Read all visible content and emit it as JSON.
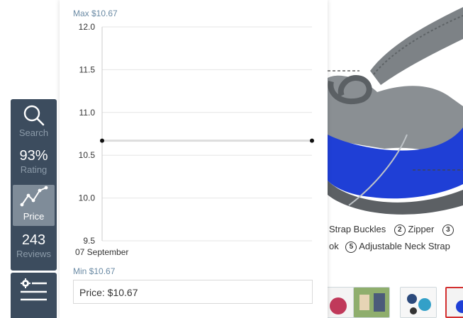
{
  "sidebar": {
    "search_label": "Search",
    "rating_value": "93%",
    "rating_label": "Rating",
    "price_label": "Price",
    "reviews_value": "243",
    "reviews_label": "Reviews"
  },
  "chart": {
    "max_label": "Max $10.67",
    "min_label": "Min $10.67",
    "price_display": "Price: $10.67"
  },
  "chart_data": {
    "type": "line",
    "x": [
      "07 September"
    ],
    "y_ticks": [
      "12.0",
      "11.5",
      "11.0",
      "10.5",
      "10.0",
      "9.5"
    ],
    "ylim": [
      9.5,
      12.0
    ],
    "grid": true,
    "series": [
      {
        "values": [
          10.67,
          10.67
        ]
      }
    ]
  },
  "product": {
    "features_line1": "Strap Buckles",
    "n2": "2",
    "features_zipper": "Zipper",
    "n3": "3",
    "features_line2_prefix": "ok",
    "n5": "5",
    "features_neck": "Adjustable Neck Strap"
  },
  "colors": {
    "sidebar_bg": "#3c4c5e",
    "sidebar_active": "#7f8c99",
    "accent_label": "#6a8aa4",
    "bag_blue": "#1f3fd6",
    "bag_gray": "#7d8286"
  }
}
